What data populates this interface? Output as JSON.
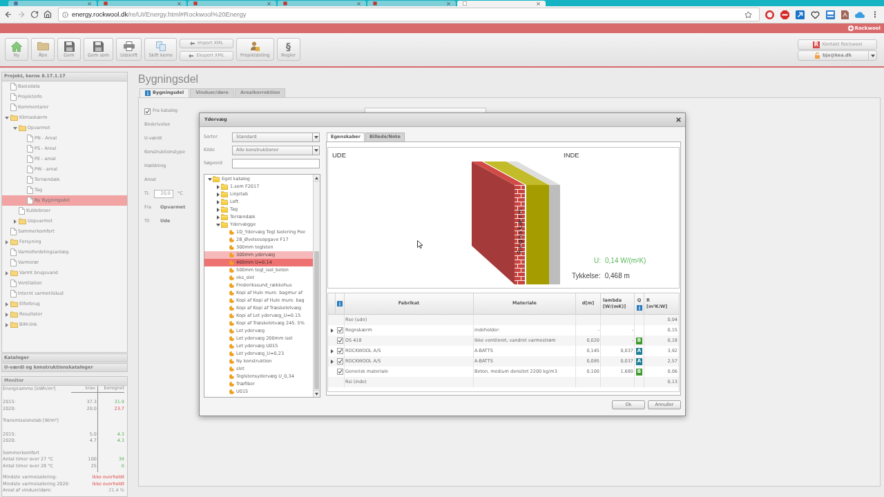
{
  "browser": {
    "tabs": [
      {
        "selected": false,
        "color": "#3f6fb5"
      },
      {
        "selected": false,
        "color": "#c9302c"
      },
      {
        "selected": false,
        "color": "#c9302c"
      },
      {
        "selected": false,
        "color": "#c9302c"
      },
      {
        "selected": false,
        "color": "#c9302c"
      },
      {
        "selected": true,
        "color": "#ffffff"
      }
    ],
    "url_host": "energy.rockwool.dk",
    "url_path": "/re/UI/Energy.html#Rockwool%20Energy"
  },
  "header": {
    "brand": "Rockwool"
  },
  "toolbar": {
    "buttons": [
      {
        "label": "Ny",
        "kind": "home"
      },
      {
        "label": "Åbn",
        "kind": "folder"
      },
      {
        "label": "Gem",
        "kind": "save"
      },
      {
        "label": "Gem som",
        "kind": "save"
      },
      {
        "label": "Udskrift",
        "kind": "print"
      },
      {
        "label": "Skift kerne",
        "kind": "switch"
      }
    ],
    "xml_buttons": [
      "Import XML",
      "Eksport XML"
    ],
    "more_buttons": [
      {
        "label": "Projektdeling",
        "kind": "share"
      },
      {
        "label": "Regler",
        "kind": "rules",
        "glyph": "§"
      }
    ],
    "contact": {
      "logo": "R",
      "label": "Kontakt Rockwool"
    },
    "user": "bja@kea.dk"
  },
  "sidebar": {
    "title": "Projekt, kerne 8.17.1.17",
    "tree": [
      {
        "label": "Basisdata",
        "kind": "page",
        "selected": false
      },
      {
        "label": "Projektinfo",
        "kind": "page",
        "selected": false
      },
      {
        "label": "Kommentarer",
        "kind": "page",
        "selected": false
      },
      {
        "label": "Klimaskærm",
        "kind": "folder",
        "expanded": true,
        "selected": false,
        "children": [
          {
            "label": "Opvarmet",
            "kind": "folder",
            "expanded": true,
            "selected": false,
            "children": [
              {
                "label": "PN - Areal",
                "kind": "page",
                "selected": false
              },
              {
                "label": "PS - Areal",
                "kind": "page",
                "selected": false
              },
              {
                "label": "PE - areal",
                "kind": "page",
                "selected": false
              },
              {
                "label": "PW - areal",
                "kind": "page",
                "selected": false
              },
              {
                "label": "Terrændæk",
                "kind": "page",
                "selected": false
              },
              {
                "label": "Tag",
                "kind": "page",
                "selected": false
              },
              {
                "label": "Ny Bygningsdel",
                "kind": "page",
                "selected": true
              }
            ]
          },
          {
            "label": "Kuldebroer",
            "kind": "page",
            "selected": false
          },
          {
            "label": "Uopvarmet",
            "kind": "folder",
            "expanded": false,
            "selected": false
          }
        ]
      },
      {
        "label": "Sommerkomfort",
        "kind": "page",
        "selected": false
      },
      {
        "label": "Forsyning",
        "kind": "folder",
        "expanded": false,
        "selected": false
      },
      {
        "label": "Varmefordelingsanlæg",
        "kind": "page",
        "selected": false
      },
      {
        "label": "Varmerør",
        "kind": "page",
        "selected": false
      },
      {
        "label": "Varmt brugsvand",
        "kind": "folder",
        "expanded": false,
        "selected": false
      },
      {
        "label": "Ventilation",
        "kind": "page",
        "selected": false
      },
      {
        "label": "Internt varmetilskud",
        "kind": "page",
        "selected": false
      },
      {
        "label": "Elforbrug",
        "kind": "folder",
        "expanded": false,
        "selected": false
      },
      {
        "label": "Resultater",
        "kind": "folder",
        "expanded": false,
        "selected": false
      },
      {
        "label": "BIM-link",
        "kind": "folder",
        "expanded": false,
        "selected": false
      }
    ],
    "sections": [
      "Kataloger",
      "U-værdi og konstruktionskataloger"
    ],
    "monitor": {
      "title": "Monitor",
      "groups": [
        {
          "heading": "Energiramme [kWh/m²]",
          "columns": [
            "krav",
            "beregnet"
          ],
          "rows": [
            {
              "label": "2015:",
              "krav": "37.3",
              "beregnet": "31.9",
              "failed": false
            },
            {
              "label": "2020:",
              "krav": "20.0",
              "beregnet": "23.7",
              "failed": true
            }
          ]
        },
        {
          "heading": "Transmissionstab [W/m²]",
          "rows": [
            {
              "label": "2015:",
              "krav": "5.0",
              "beregnet": "4.3",
              "failed": false
            },
            {
              "label": "2020:",
              "krav": "4.7",
              "beregnet": "4.3",
              "failed": false
            }
          ]
        },
        {
          "heading": "Sommerkomfort",
          "rows": [
            {
              "label": "Antal timer over 27 °C",
              "krav": "100",
              "beregnet": "39",
              "failed": false
            },
            {
              "label": "Antal timer over 28 °C",
              "krav": "25",
              "beregnet": "0",
              "failed": false
            }
          ]
        }
      ],
      "summary": [
        {
          "label": "Mindste varmeisolering:",
          "value": "Ikke overholdt",
          "failed": true
        },
        {
          "label": "Mindste varmeisolering 2020:",
          "value": "Ikke overholdt",
          "failed": true
        },
        {
          "label": "Areal af vinduer/døre:",
          "value": "21.4 %",
          "failed": false
        }
      ]
    }
  },
  "main": {
    "title": "Bygningsdel",
    "tabs": [
      {
        "label": "Bygningsdel",
        "selected": true,
        "info": true
      },
      {
        "label": "Vinduer/døre",
        "selected": false,
        "info": false
      },
      {
        "label": "Arealkorrektion",
        "selected": false,
        "info": false
      }
    ],
    "form": {
      "from_catalog": {
        "label": "Fra katalog",
        "checked": true
      },
      "fields": [
        "Beskrivelse",
        "U-værdi",
        "Konstruktionstype",
        "Hældning",
        "Areal"
      ],
      "ti": {
        "label": "Ti:",
        "value": "20,0",
        "unit": "°C"
      },
      "from": {
        "label": "Fra",
        "value": "Opvarmet"
      },
      "to": {
        "label": "Til",
        "value": "Ude"
      }
    }
  },
  "dialog": {
    "title": "Ydervæg",
    "filters": [
      {
        "label": "Sorter",
        "kind": "select",
        "value": "Standard"
      },
      {
        "label": "Kilde",
        "kind": "select",
        "value": "Alle konstruktioner"
      },
      {
        "label": "Søgeord",
        "kind": "input"
      }
    ],
    "catalog": [
      {
        "label": "Eget katalog",
        "kind": "folder",
        "expanded": true,
        "selected": false,
        "hovered": false,
        "children": [
          {
            "label": "1.sem F2017",
            "kind": "folder",
            "expanded": false,
            "selected": false,
            "hovered": false
          },
          {
            "label": "Linjetab",
            "kind": "folder",
            "expanded": false,
            "selected": false,
            "hovered": false
          },
          {
            "label": "Loft",
            "kind": "folder",
            "expanded": false,
            "selected": false,
            "hovered": false
          },
          {
            "label": "Tag",
            "kind": "folder",
            "expanded": false,
            "selected": false,
            "hovered": false
          },
          {
            "label": "Terrændæk",
            "kind": "folder",
            "expanded": false,
            "selected": false,
            "hovered": false
          },
          {
            "label": "Ydervægge",
            "kind": "folder",
            "expanded": true,
            "selected": false,
            "hovered": false,
            "children": [
              {
                "label": "1D_Ydervæg Tegl Isolering Poe",
                "kind": "construction",
                "selected": false,
                "hovered": false
              },
              {
                "label": "2B_Øvelsesopgave F17",
                "kind": "construction",
                "selected": false,
                "hovered": false
              },
              {
                "label": "300mm teglsten",
                "kind": "construction",
                "selected": false,
                "hovered": false
              },
              {
                "label": "300mm ydervæg",
                "kind": "construction",
                "selected": false,
                "hovered": true
              },
              {
                "label": "468mm U=0,14",
                "kind": "construction",
                "selected": true,
                "hovered": false
              },
              {
                "label": "500mm tegl_isol_beton",
                "kind": "construction",
                "selected": false,
                "hovered": false
              },
              {
                "label": "eks_slet",
                "kind": "construction",
                "selected": false,
                "hovered": false
              },
              {
                "label": "Frederikssund_rækkehus",
                "kind": "construction",
                "selected": false,
                "hovered": false
              },
              {
                "label": "Kopi af Hule mure. bagmur af",
                "kind": "construction",
                "selected": false,
                "hovered": false
              },
              {
                "label": "Kopi af Kopi af Hule mure. bag",
                "kind": "construction",
                "selected": false,
                "hovered": false
              },
              {
                "label": "Kopi af Kopi af Træskeletvæg",
                "kind": "construction",
                "selected": false,
                "hovered": false
              },
              {
                "label": "Kopi af Let ydervæg_U=0.15",
                "kind": "construction",
                "selected": false,
                "hovered": false
              },
              {
                "label": "Kopi af Træskeletvæg 245. 5%",
                "kind": "construction",
                "selected": false,
                "hovered": false
              },
              {
                "label": "Let ydervæg",
                "kind": "construction",
                "selected": false,
                "hovered": false
              },
              {
                "label": "Let ydervæg 200mm isol",
                "kind": "construction",
                "selected": false,
                "hovered": false
              },
              {
                "label": "Let ydervæg U015",
                "kind": "construction",
                "selected": false,
                "hovered": false
              },
              {
                "label": "Let ydervæg_U=0,23",
                "kind": "construction",
                "selected": false,
                "hovered": false
              },
              {
                "label": "Ny konstruktion",
                "kind": "construction",
                "selected": false,
                "hovered": false
              },
              {
                "label": "slet",
                "kind": "construction",
                "selected": false,
                "hovered": false
              },
              {
                "label": "Teglstensydervæg U_0,34",
                "kind": "construction",
                "selected": false,
                "hovered": false
              },
              {
                "label": "Træfiber",
                "kind": "construction",
                "selected": false,
                "hovered": false
              },
              {
                "label": "U015",
                "kind": "construction",
                "selected": false,
                "hovered": false
              }
            ]
          }
        ]
      }
    ],
    "tabs": [
      {
        "label": "Egenskaber",
        "selected": true
      },
      {
        "label": "Billede/Note",
        "selected": false
      }
    ],
    "preview": {
      "outside": "UDE",
      "inside": "INDE",
      "layer_label": "Regnskærm",
      "u_label": "U:",
      "u_value": "0,14 W/(m²K)",
      "thickness_label": "Tykkelse:",
      "thickness_value": "0,468 m"
    },
    "table": {
      "columns": [
        "Fabrikat",
        "Materiale",
        "d[m]",
        "lambda [W/(mK)]",
        "Q",
        "R [m²K/W]"
      ],
      "rows": [
        {
          "kind": "surface",
          "expandable": false,
          "fabrikat": "Rse (ude)",
          "r": "0,04"
        },
        {
          "kind": "layer",
          "expandable": true,
          "checked": true,
          "fabrikat": "Regnskærm",
          "materiale": "indeholder:",
          "d": "-",
          "lambda": "-",
          "r": "0,15"
        },
        {
          "kind": "layer",
          "expandable": false,
          "checked": true,
          "fabrikat": "DS 418",
          "materiale": "Ikke ventileret, vandret varmestrøm",
          "d": "0,020",
          "lambda": "-",
          "q": {
            "grade": "B",
            "color": "#3f9a2e"
          },
          "r": "0,18"
        },
        {
          "kind": "layer",
          "expandable": true,
          "checked": true,
          "fabrikat": "ROCKWOOL A/S",
          "materiale": "A-BATTS",
          "d": "0,145",
          "lambda": "0,037",
          "q": {
            "grade": "A",
            "color": "#1f7f93"
          },
          "r": "3,92"
        },
        {
          "kind": "layer",
          "expandable": true,
          "checked": true,
          "fabrikat": "ROCKWOOL A/S",
          "materiale": "A-BATTS",
          "d": "0,095",
          "lambda": "0,037",
          "q": {
            "grade": "A",
            "color": "#1f7f93"
          },
          "r": "2,57"
        },
        {
          "kind": "layer",
          "expandable": false,
          "checked": true,
          "fabrikat": "Generisk materiale",
          "materiale": "Beton, medium densitet 2200 kg/m3",
          "d": "0,100",
          "lambda": "1,680",
          "q": {
            "grade": "B",
            "color": "#3f9a2e"
          },
          "r": "0,06"
        },
        {
          "kind": "surface",
          "expandable": false,
          "fabrikat": "Rsi (inde)",
          "r": "0,13"
        }
      ]
    },
    "buttons": [
      "Ok",
      "Annuller"
    ]
  }
}
